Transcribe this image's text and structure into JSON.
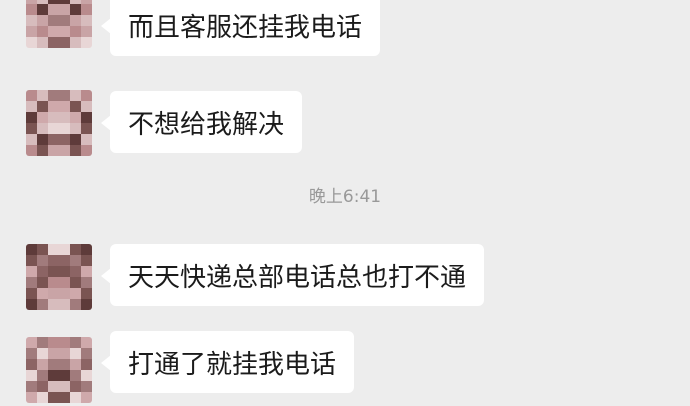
{
  "timestamp": "晚上6:41",
  "messages": [
    {
      "text": "而且客服还挂我电话"
    },
    {
      "text": "不想给我解决"
    },
    {
      "text": "天天快递总部电话总也打不通"
    },
    {
      "text": "打通了就挂我电话"
    }
  ],
  "avatar": {
    "icon": "pixelated-avatar-icon",
    "palette": [
      "#c9a4a6",
      "#d7bcbd",
      "#7a5452",
      "#a17b7c",
      "#e8d6d6",
      "#b98b8d",
      "#5e3b3a",
      "#cfa9ab",
      "#8c6464"
    ]
  },
  "colors": {
    "background": "#ededed",
    "bubble": "#ffffff",
    "text": "#1b1b1b",
    "timestamp": "#999999"
  }
}
